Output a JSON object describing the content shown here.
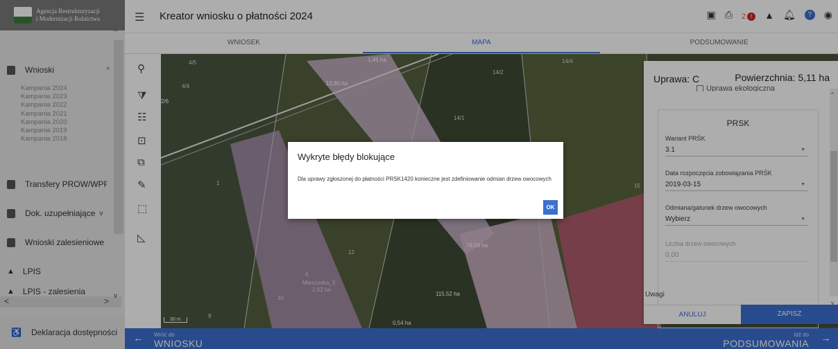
{
  "brand": {
    "line1": "Agencja Restrukturyzacji",
    "line2": "i Modernizacji Rolnictwa"
  },
  "header": {
    "title": "Kreator wniosku o płatności 2024",
    "error_count": "2",
    "error_badge": "!"
  },
  "tabs": [
    {
      "label": "WNIOSEK"
    },
    {
      "label": "MAPA"
    },
    {
      "label": "PODSUMOWANIE"
    }
  ],
  "sidebar": {
    "items": [
      {
        "label": "Wnioski",
        "chevron": "^"
      },
      {
        "label": "Transfery PROW/WPR"
      },
      {
        "label": "Dok. uzupełniające",
        "chevron": "v"
      },
      {
        "label": "Wnioski zalesieniowe"
      },
      {
        "label": "LPIS"
      },
      {
        "label": "LPIS - zalesienia"
      }
    ],
    "campaigns": [
      "Kampania 2024",
      "Kampania 2023",
      "Kampania 2022",
      "Kampania 2021",
      "Kampania 2020",
      "Kampania 2019",
      "Kampania 2018"
    ],
    "accessibility": "Deklaracja dostępności"
  },
  "map": {
    "labels": [
      "4/5",
      "4/4",
      "1,46 ha",
      "12,80 ha",
      "14/2",
      "14/4",
      "2/6",
      "14/1",
      "1",
      "12",
      "79,58 ha",
      "6",
      "Mieszanka_3",
      "2,62 ha",
      "10",
      "9",
      "115,52 ha",
      "0,54 ha",
      "15",
      "30 m"
    ]
  },
  "panel": {
    "crop_label": "Uprawa: C",
    "area_label": "Powierzchnia: 5,11 ha",
    "eco_label": "Uprawa ekologiczna",
    "prsk_title": "PRSK",
    "fields": [
      {
        "label": "Wariant PRŚK",
        "value": "3.1"
      },
      {
        "label": "Data rozpoczęcia zobowiązania PRŚK",
        "value": "2019-03-15"
      },
      {
        "label": "Odmiana/gatunek drzew owocowych",
        "value": "Wybierz"
      },
      {
        "label": "Liczba drzew owocowych",
        "value": "0,00"
      }
    ],
    "notes_label": "Uwagi",
    "cancel_label": "ANULUJ",
    "save_label": "ZAPISZ"
  },
  "footer": {
    "prev_small": "Wróć do",
    "prev_big": "WNIOSKU",
    "next_small": "Idź do",
    "next_big": "PODSUMOWANIA"
  },
  "dialog": {
    "title": "Wykryte błędy blokujące",
    "message": "Dla uprawy zgłoszonej do płatności PRSK1420 konieczne jest zdefiniowanie odmian drzew owocowych",
    "ok_label": "OK"
  },
  "colors": {
    "accent": "#3b6fd1",
    "error": "#c62828"
  }
}
